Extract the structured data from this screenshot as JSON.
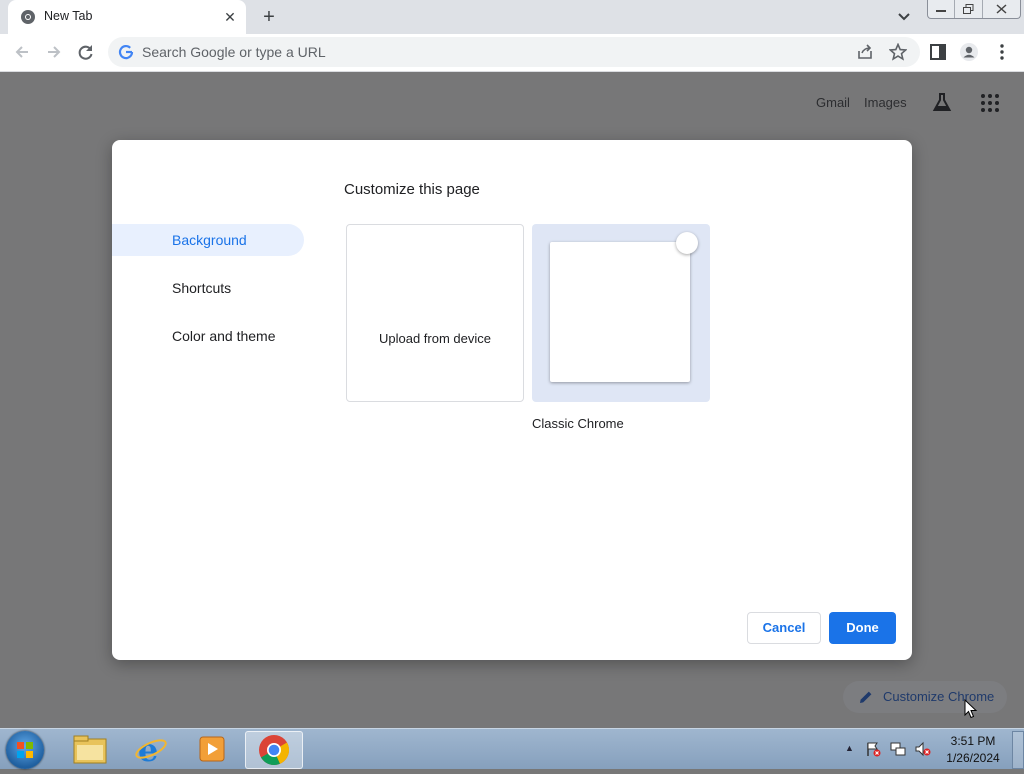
{
  "browser": {
    "tab": {
      "title": "New Tab",
      "favicon": "chrome-icon",
      "close_icon": "close-icon"
    },
    "new_tab_icon": "plus-icon",
    "omnibox": {
      "placeholder": "Search Google or type a URL"
    }
  },
  "ntp": {
    "links": {
      "gmail": "Gmail",
      "images": "Images"
    },
    "customize_chip": "Customize Chrome"
  },
  "dialog": {
    "title": "Customize this page",
    "nav": [
      {
        "label": "Background",
        "selected": true
      },
      {
        "label": "Shortcuts",
        "selected": false
      },
      {
        "label": "Color and theme",
        "selected": false
      }
    ],
    "tiles": {
      "upload_label": "Upload from device",
      "classic_label": "Classic Chrome",
      "classic_selected": true
    },
    "buttons": {
      "cancel": "Cancel",
      "done": "Done"
    }
  },
  "taskbar": {
    "apps": [
      "windows-explorer",
      "internet-explorer",
      "media-player",
      "chrome"
    ],
    "clock": {
      "time": "3:51 PM",
      "date": "1/26/2024"
    }
  },
  "colors": {
    "accent": "#1a73e8",
    "selected_bg": "#e8f0fe",
    "overlay": "#777778"
  }
}
